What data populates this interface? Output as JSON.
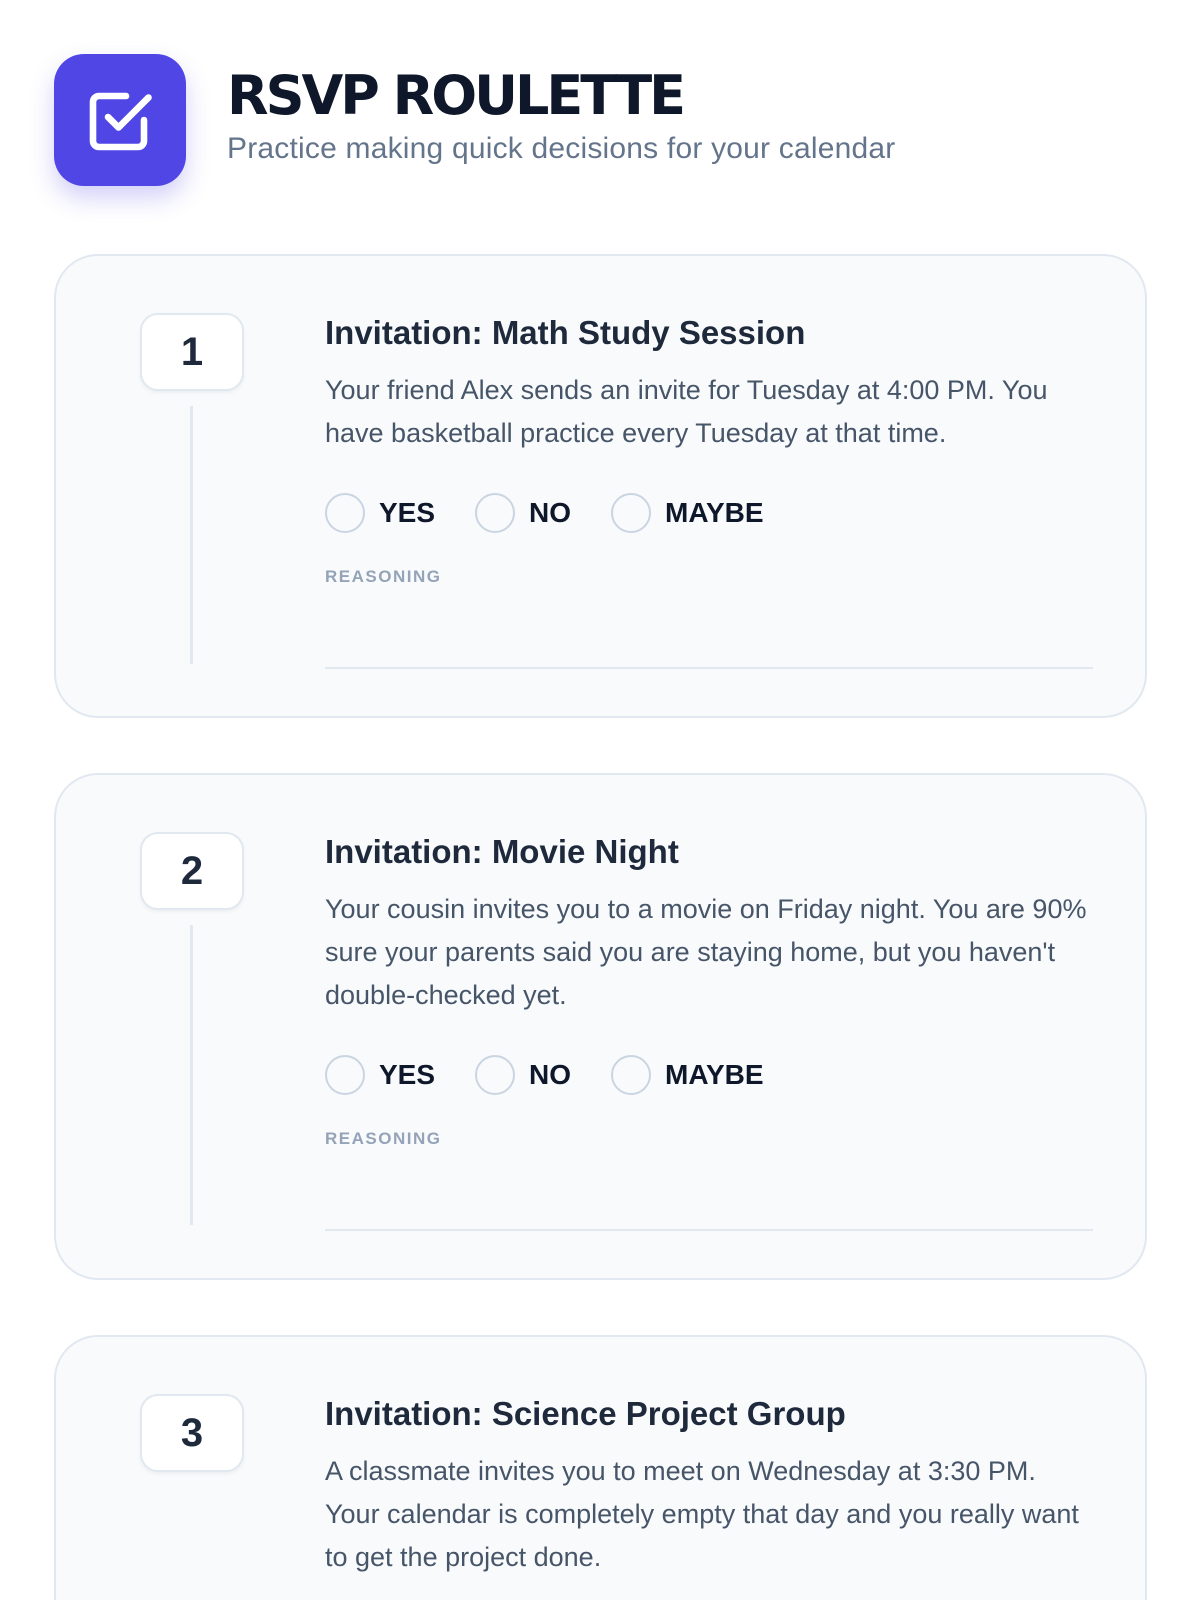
{
  "app": {
    "title": "RSVP ROULETTE",
    "subtitle": "Practice making quick decisions for your calendar",
    "logo_icon": "checkbox-check-icon",
    "accent_color": "#4f46e5"
  },
  "invitations": [
    {
      "number": "1",
      "title": "Invitation: Math Study Session",
      "description": "Your friend Alex sends an invite for Tuesday at 4:00 PM. You have basketball practice every Tuesday at that time.",
      "options": [
        "YES",
        "NO",
        "MAYBE"
      ],
      "reasoning_label": "REASONING",
      "reasoning_value": ""
    },
    {
      "number": "2",
      "title": "Invitation: Movie Night",
      "description": "Your cousin invites you to a movie on Friday night. You are 90% sure your parents said you are staying home, but you haven't double-checked yet.",
      "options": [
        "YES",
        "NO",
        "MAYBE"
      ],
      "reasoning_label": "REASONING",
      "reasoning_value": ""
    },
    {
      "number": "3",
      "title": "Invitation: Science Project Group",
      "description": "A classmate invites you to meet on Wednesday at 3:30 PM. Your calendar is completely empty that day and you really want to get the project done."
    }
  ]
}
